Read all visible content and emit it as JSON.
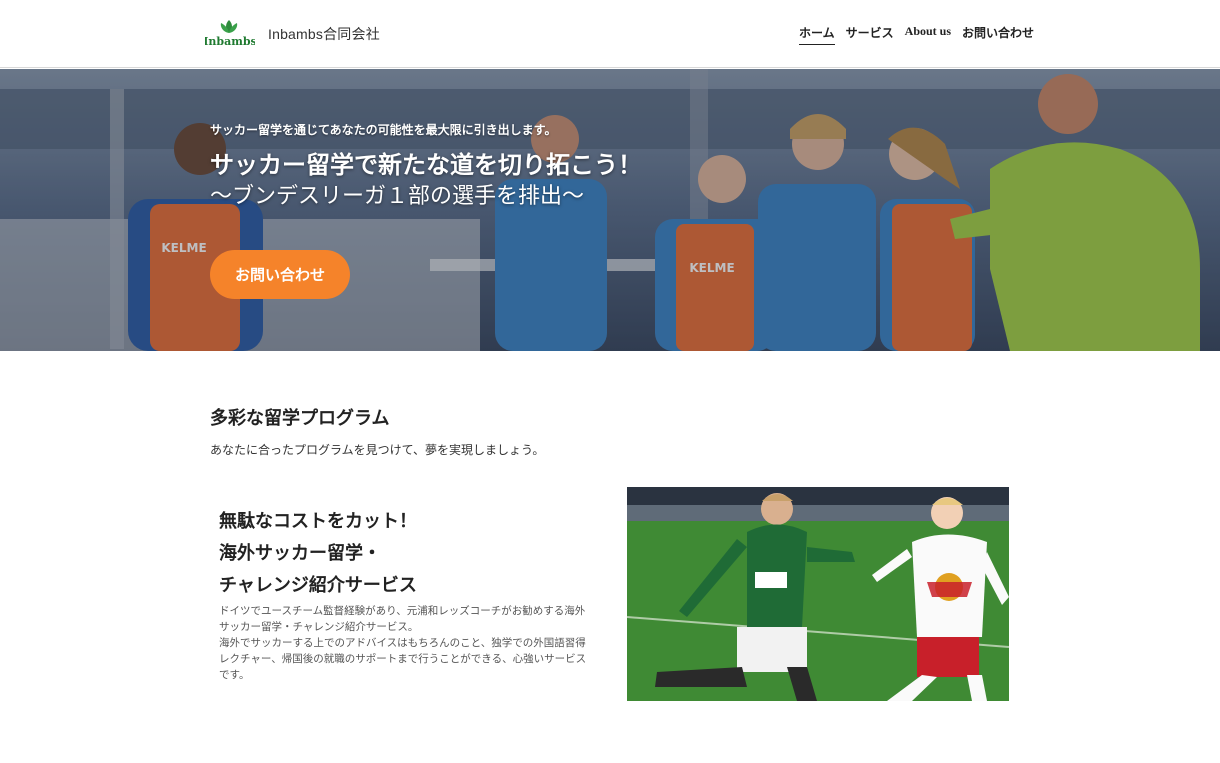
{
  "header": {
    "logo_text": "Inbambs",
    "brand_name": "Inbambs合同会社",
    "nav": [
      {
        "label": "ホーム",
        "active": true
      },
      {
        "label": "サービス",
        "active": false
      },
      {
        "label": "About us",
        "active": false
      },
      {
        "label": "お問い合わせ",
        "active": false
      }
    ]
  },
  "hero": {
    "subtitle": "サッカー留学を通じてあなたの可能性を最大限に引き出します。",
    "title_line1": "サッカー留学で新たな道を切り拓こう！",
    "title_line2": "〜ブンデスリーガ１部の選手を排出〜",
    "cta_label": "お問い合わせ",
    "bib_text": "KELME",
    "cta_color": "#f5832a"
  },
  "programs": {
    "title": "多彩な留学プログラム",
    "description": "あなたに合ったプログラムを見つけて、夢を実現しましょう。"
  },
  "feature": {
    "title_lines": [
      "無駄なコストをカット！",
      "海外サッカー留学・",
      "チャレンジ紹介サービス"
    ],
    "body_lines": [
      "ドイツでユースチーム監督経験があり、元浦和レッズコーチがお勧めする海外",
      "サッカー留学・チャレンジ紹介サービス。",
      "海外でサッカーする上でのアドバイスはもちろんのこと、独学での外国語習得",
      "レクチャー、帰国後の就職のサポートまで行うことができる、心強いサービス",
      "です。"
    ],
    "image_alt": "soccer-match-photo"
  }
}
